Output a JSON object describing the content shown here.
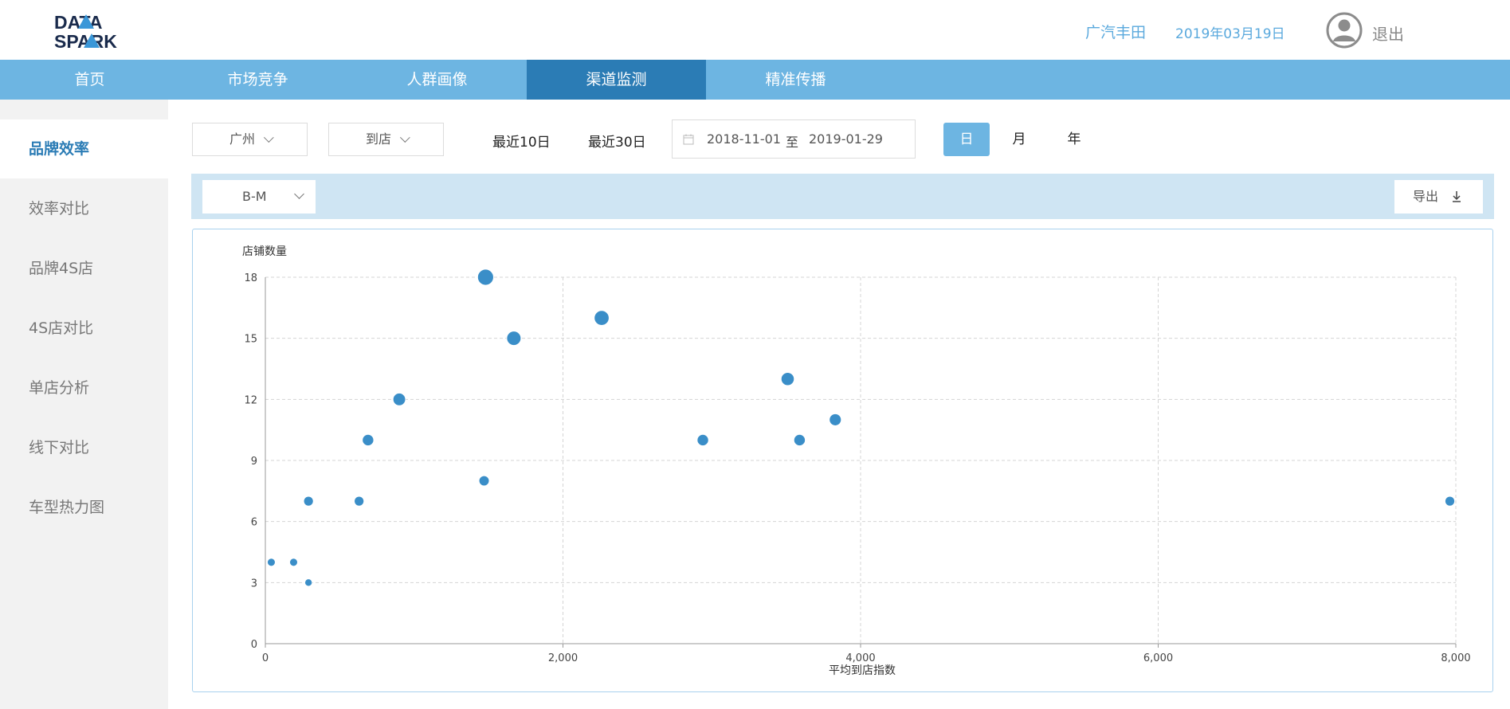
{
  "brand": {
    "logo_line1": "DATA",
    "logo_line2": "SPARK"
  },
  "header": {
    "company": "广汽丰田",
    "date": "2019年03月19日",
    "logout_label": "退出"
  },
  "nav": {
    "items": [
      {
        "label": "首页"
      },
      {
        "label": "市场竞争"
      },
      {
        "label": "人群画像"
      },
      {
        "label": "渠道监测",
        "active": true
      },
      {
        "label": "精准传播"
      }
    ]
  },
  "sidebar": {
    "items": [
      {
        "label": "品牌效率",
        "active": true
      },
      {
        "label": "效率对比"
      },
      {
        "label": "品牌4S店"
      },
      {
        "label": "4S店对比"
      },
      {
        "label": "单店分析"
      },
      {
        "label": "线下对比"
      },
      {
        "label": "车型热力图"
      }
    ]
  },
  "filters": {
    "city": "广州",
    "metric": "到店",
    "quick_10": "最近10日",
    "quick_30": "最近30日",
    "date_start": "2018-11-01",
    "date_sep": "至",
    "date_end": "2019-01-29",
    "granularity": [
      {
        "label": "日",
        "active": true
      },
      {
        "label": "月"
      },
      {
        "label": "年"
      }
    ]
  },
  "toolbar": {
    "segment": "B-M",
    "export_label": "导出"
  },
  "colors": {
    "nav_bg": "#6db5e2",
    "nav_active": "#2b7cb5",
    "accent_text": "#5aa9dd",
    "point": "#3a8ec8"
  },
  "chart_data": {
    "type": "scatter",
    "xlabel": "平均到店指数",
    "ylabel": "店铺数量",
    "xlim": [
      0,
      8000
    ],
    "ylim": [
      0,
      18
    ],
    "xticks": [
      0,
      2000,
      4000,
      6000,
      8000
    ],
    "xtick_labels": [
      "0",
      "2,000",
      "4,000",
      "6,000",
      "8,000"
    ],
    "yticks": [
      0,
      3,
      6,
      9,
      12,
      15,
      18
    ],
    "ytick_labels": [
      "0",
      "3",
      "6",
      "9",
      "12",
      "15",
      "18"
    ],
    "grid": true,
    "points": [
      {
        "x": 40,
        "y": 4
      },
      {
        "x": 190,
        "y": 4
      },
      {
        "x": 290,
        "y": 3
      },
      {
        "x": 290,
        "y": 7
      },
      {
        "x": 630,
        "y": 7
      },
      {
        "x": 690,
        "y": 10
      },
      {
        "x": 900,
        "y": 12
      },
      {
        "x": 1470,
        "y": 8
      },
      {
        "x": 1480,
        "y": 18
      },
      {
        "x": 1670,
        "y": 15
      },
      {
        "x": 2260,
        "y": 16
      },
      {
        "x": 2940,
        "y": 10
      },
      {
        "x": 3510,
        "y": 13
      },
      {
        "x": 3590,
        "y": 10
      },
      {
        "x": 3830,
        "y": 11
      },
      {
        "x": 7960,
        "y": 7
      }
    ]
  }
}
